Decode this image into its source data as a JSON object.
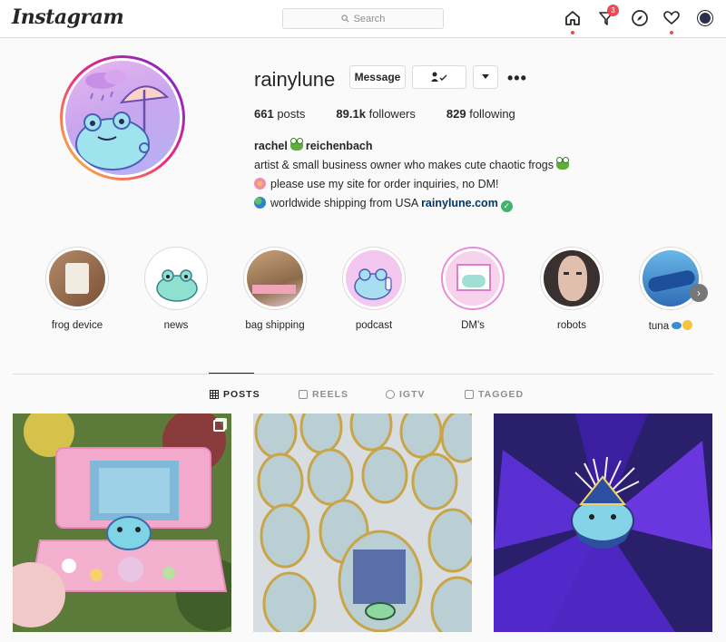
{
  "app": {
    "logo_text": "Instagram"
  },
  "search": {
    "placeholder": "Search"
  },
  "nav": {
    "icons": [
      "home-icon",
      "activity-icon",
      "explore-icon",
      "heart-icon",
      "profile-avatar"
    ],
    "activity_badge": "3"
  },
  "profile": {
    "username": "rainylune",
    "message_label": "Message",
    "more_label": "•••",
    "stats": {
      "posts_count": "661",
      "posts_label": "posts",
      "followers_count": "89.1k",
      "followers_label": "followers",
      "following_count": "829",
      "following_label": "following"
    },
    "bio": {
      "name_first": "rachel",
      "name_last": "reichenbach",
      "line1": "artist & small business owner who makes cute chaotic frogs",
      "line2": "please use my site for order inquiries, no DM!",
      "line3": "worldwide shipping from USA",
      "link": "rainylune.com"
    }
  },
  "highlights": [
    {
      "label": "frog device"
    },
    {
      "label": "news"
    },
    {
      "label": "bag shipping"
    },
    {
      "label": "podcast"
    },
    {
      "label": "DM's"
    },
    {
      "label": "robots"
    },
    {
      "label": "tuna"
    }
  ],
  "tabs": [
    {
      "label": "POSTS",
      "active": true
    },
    {
      "label": "REELS",
      "active": false
    },
    {
      "label": "IGTV",
      "active": false
    },
    {
      "label": "TAGGED",
      "active": false
    }
  ],
  "colors": {
    "accent_red": "#ed4956",
    "link": "#00376b",
    "border": "#dbdbdb",
    "muted": "#8e8e8e"
  }
}
